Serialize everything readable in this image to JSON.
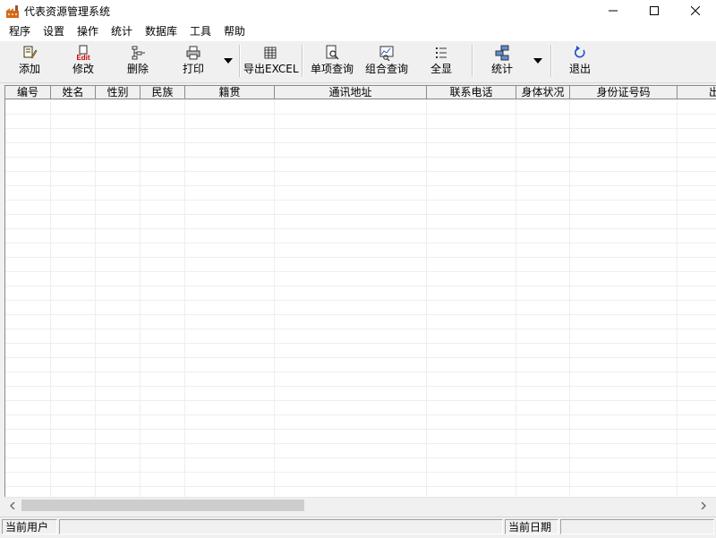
{
  "window": {
    "title": "代表资源管理系统",
    "app_icon": "factory-icon"
  },
  "menubar": {
    "items": [
      "程序",
      "设置",
      "操作",
      "统计",
      "数据库",
      "工具",
      "帮助"
    ]
  },
  "toolbar": {
    "add": {
      "label": "添加",
      "icon": "pencil-note-icon"
    },
    "edit": {
      "label": "修改",
      "icon": "edit-document-icon",
      "icon_text": "Edit",
      "icon_color": "#cc0000"
    },
    "delete": {
      "label": "删除",
      "icon": "delete-tree-icon"
    },
    "print": {
      "label": "打印",
      "icon": "printer-icon"
    },
    "export": {
      "label": "导出EXCEL",
      "icon": "spreadsheet-icon"
    },
    "single_query": {
      "label": "单项查询",
      "icon": "document-search-icon"
    },
    "combo_query": {
      "label": "组合查询",
      "icon": "chart-search-icon"
    },
    "show_all": {
      "label": "全显",
      "icon": "list-icon"
    },
    "stats": {
      "label": "统计",
      "icon": "network-stats-icon"
    },
    "exit": {
      "label": "退出",
      "icon": "refresh-exit-icon",
      "icon_color": "#1e50c8"
    }
  },
  "grid": {
    "columns": [
      "编号",
      "姓名",
      "性别",
      "民族",
      "籍贯",
      "通讯地址",
      "联系电话",
      "身体状况",
      "身份证号码",
      "出"
    ],
    "rows": []
  },
  "statusbar": {
    "current_user_label": "当前用户",
    "current_user_value": "",
    "current_date_label": "当前日期",
    "current_date_value": ""
  },
  "colors": {
    "background": "#f0f0f0",
    "grid_line": "#eeeeee",
    "header_border": "#8c8c8c",
    "scroll_thumb": "#cdcdcd"
  }
}
